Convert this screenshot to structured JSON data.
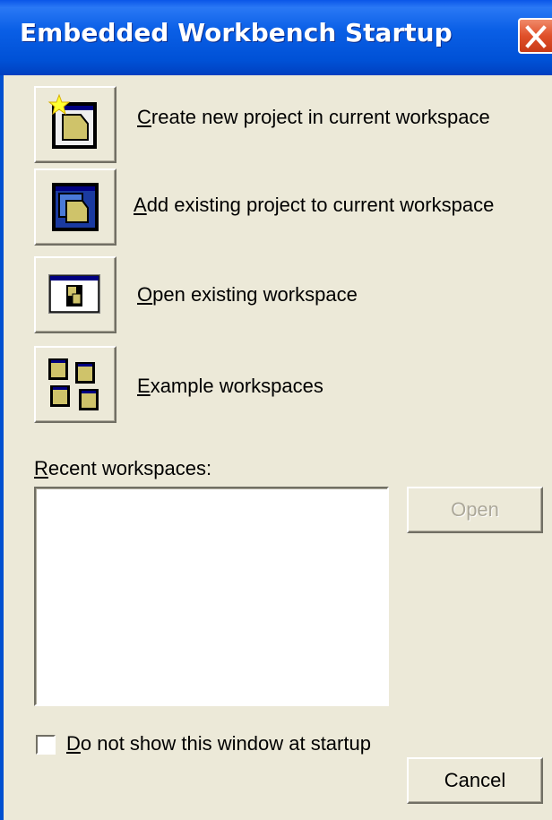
{
  "window": {
    "title": "Embedded Workbench Startup"
  },
  "actions": [
    {
      "mnemonic": "C",
      "rest": "reate new project in current workspace",
      "icon": "new-project-icon"
    },
    {
      "mnemonic": "A",
      "rest": "dd existing project to current workspace",
      "icon": "add-project-icon"
    },
    {
      "mnemonic": "O",
      "rest": "pen existing workspace",
      "icon": "open-workspace-icon"
    },
    {
      "mnemonic": "E",
      "rest": "xample workspaces",
      "icon": "example-workspaces-icon"
    }
  ],
  "recent": {
    "label_mnemonic": "R",
    "label_rest": "ecent workspaces:",
    "items": []
  },
  "buttons": {
    "open_label": "Open",
    "open_enabled": false,
    "cancel_label": "Cancel"
  },
  "startup_option": {
    "label_mnemonic": "D",
    "label_rest": "o not show this window at startup",
    "checked": false
  }
}
